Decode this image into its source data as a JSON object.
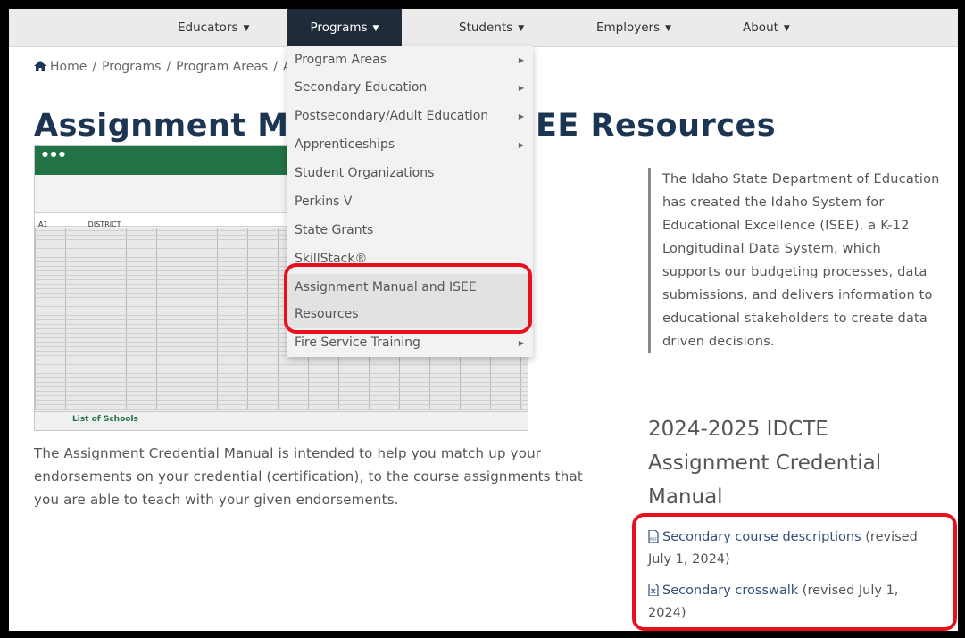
{
  "nav": {
    "items": [
      {
        "label": "Educators",
        "caret": "▼"
      },
      {
        "label": "Programs",
        "caret": "▼"
      },
      {
        "label": "Students",
        "caret": "▼"
      },
      {
        "label": "Employers",
        "caret": "▼"
      },
      {
        "label": "About",
        "caret": "▼"
      }
    ]
  },
  "breadcrumb": {
    "items": [
      "Home",
      "Programs",
      "Program Areas",
      "A"
    ],
    "separator": "/"
  },
  "page": {
    "title_left": "Assignment M",
    "title_right": "EE Resources"
  },
  "spreadsheet": {
    "sheet_tab": "List of Schools",
    "cell_ref": "A1",
    "formula": "DISTRICT"
  },
  "body": {
    "text": "The Assignment Credential Manual is intended to help you match up your endorsements on your credential (certification), to the course assignments that you are able to teach with your given endorsements."
  },
  "sidebar": {
    "quote": "The Idaho State Department of Education has created the Idaho System for Educational Excellence (ISEE), a K-12 Longitudinal Data System, which supports our budgeting processes, data submissions, and delivers information to educational stakeholders to create data driven decisions.",
    "heading": "2024-2025 IDCTE Assignment Credential Manual",
    "links": [
      {
        "label": "Secondary course descriptions",
        "note": "(revised July 1, 2024)",
        "icon": "pdf-file-icon"
      },
      {
        "label": "Secondary crosswalk",
        "note": "(revised July 1, 2024)",
        "icon": "excel-file-icon"
      }
    ]
  },
  "dropdown": {
    "items": [
      {
        "label": "Program Areas",
        "has_submenu": true
      },
      {
        "label": "Secondary Education",
        "has_submenu": true
      },
      {
        "label": "Postsecondary/Adult Education",
        "has_submenu": true
      },
      {
        "label": "Apprenticeships",
        "has_submenu": true
      },
      {
        "label": "Student Organizations",
        "has_submenu": false
      },
      {
        "label": "Perkins V",
        "has_submenu": false
      },
      {
        "label": "State Grants",
        "has_submenu": false
      },
      {
        "label": "SkillStack®",
        "has_submenu": false
      },
      {
        "label": "Assignment Manual and ISEE",
        "has_submenu": false
      },
      {
        "label": "Resources",
        "has_submenu": false
      },
      {
        "label": "Fire Service Training",
        "has_submenu": true
      }
    ],
    "arrow": "▶"
  },
  "colors": {
    "nav_active": "#1f2b38",
    "title": "#1c3553",
    "highlight": "#e8101a",
    "link": "#33507a"
  }
}
